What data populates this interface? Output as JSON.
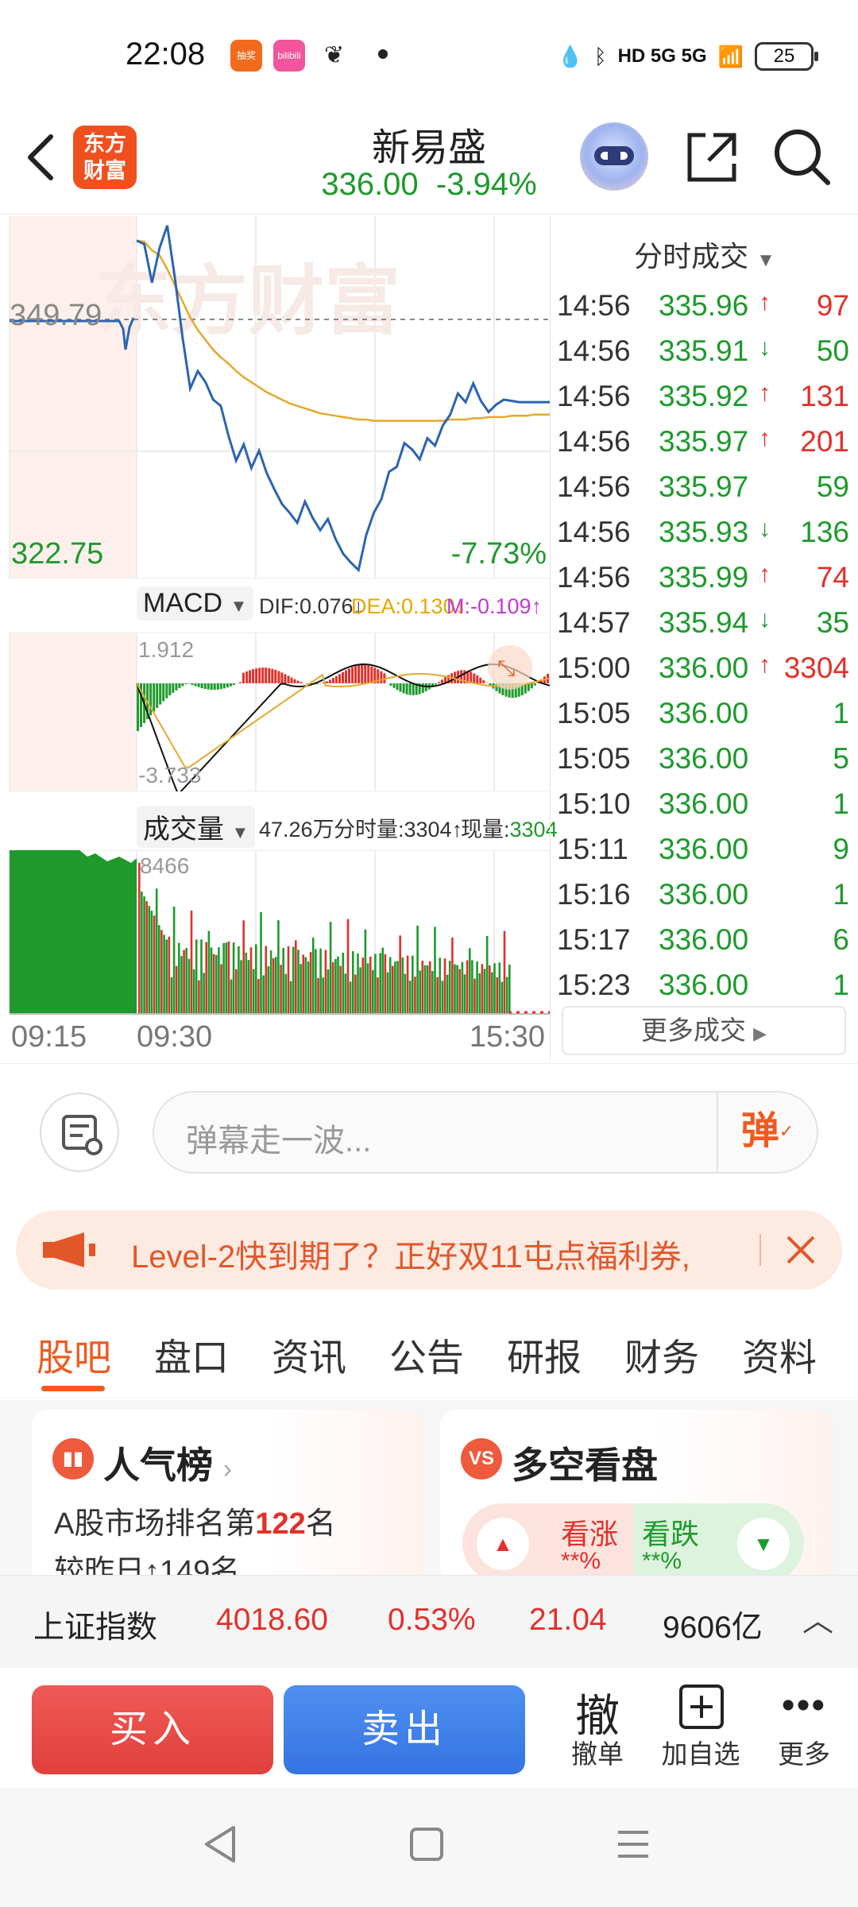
{
  "status_bar": {
    "time": "22:08",
    "app_icons": [
      "抽奖",
      "bilibili"
    ],
    "network": "HD 5G 5G",
    "battery": "25"
  },
  "header": {
    "logo_text": "东方财富",
    "stock_name": "新易盛",
    "price": "336.00",
    "change_pct": "-3.94%"
  },
  "intraday_chart": {
    "watermark": "东方财富",
    "ref_price": "349.79",
    "low_price": "322.75",
    "low_pct": "-7.73%",
    "macd": {
      "selector": "MACD",
      "dif": "DIF:0.076",
      "dea": "DEA:0.130",
      "m": "M:-0.109",
      "top_value": "1.912",
      "bottom_value": "-3.733"
    },
    "volume": {
      "selector": "成交量",
      "total": "47.26万",
      "minute_vol": "分时量:3304",
      "now_label": "现量:",
      "now_value": "3304",
      "max_value": "8466"
    },
    "time_axis": [
      "09:15",
      "09:30",
      "15:30"
    ]
  },
  "chart_data": {
    "type": "line",
    "title": "",
    "ylim": [
      322.75,
      376.83
    ],
    "ref_line": 349.79,
    "x_ticks": [
      "09:15",
      "09:30",
      "15:30"
    ],
    "series": [
      {
        "values": [
          349.79,
          349.5,
          346.4,
          349.2,
          351.0,
          346.8,
          342.0,
          337.9,
          339.3,
          338.4,
          337.0,
          336.5,
          334.1,
          332.1,
          333.4,
          331.5,
          332.9,
          331.1,
          329.8,
          328.6,
          327.9,
          327.1,
          328.8,
          327.5,
          326.5,
          327.4,
          325.8,
          324.6,
          323.9,
          323.3,
          326.1,
          327.9,
          329.0,
          331.2,
          331.6,
          333.5,
          333.0,
          332.2,
          333.9,
          333.3,
          334.9,
          335.8,
          337.5,
          336.8,
          338.3,
          336.9,
          336.0,
          336.6,
          337.0,
          336.9,
          336.8,
          336.8,
          336.8,
          336.8,
          336.8
        ]
      },
      {
        "values": [
          349.79,
          349.7,
          349.0,
          348.6,
          347.5,
          346.2,
          344.9,
          343.6,
          342.6,
          341.8,
          341.0,
          340.4,
          339.9,
          339.3,
          338.8,
          338.4,
          338.0,
          337.6,
          337.3,
          337.0,
          336.7,
          336.5,
          336.3,
          336.1,
          335.9,
          335.8,
          335.7,
          335.6,
          335.5,
          335.4,
          335.4,
          335.3,
          335.3,
          335.3,
          335.3,
          335.3,
          335.3,
          335.3,
          335.3,
          335.3,
          335.3,
          335.4,
          335.4,
          335.4,
          335.5,
          335.5,
          335.6,
          335.6,
          335.6,
          335.7,
          335.7,
          335.7,
          335.8,
          335.8,
          335.8
        ]
      }
    ]
  },
  "ticks": {
    "header": "分时成交",
    "rows": [
      {
        "time": "14:56",
        "price": "335.96",
        "dir": "↑",
        "vol": "97"
      },
      {
        "time": "14:56",
        "price": "335.91",
        "dir": "↓",
        "vol": "50"
      },
      {
        "time": "14:56",
        "price": "335.92",
        "dir": "↑",
        "vol": "131"
      },
      {
        "time": "14:56",
        "price": "335.97",
        "dir": "↑",
        "vol": "201"
      },
      {
        "time": "14:56",
        "price": "335.97",
        "dir": "",
        "vol": "59"
      },
      {
        "time": "14:56",
        "price": "335.93",
        "dir": "↓",
        "vol": "136"
      },
      {
        "time": "14:56",
        "price": "335.99",
        "dir": "↑",
        "vol": "74"
      },
      {
        "time": "14:57",
        "price": "335.94",
        "dir": "↓",
        "vol": "35"
      },
      {
        "time": "15:00",
        "price": "336.00",
        "dir": "↑",
        "vol": "3304"
      },
      {
        "time": "15:05",
        "price": "336.00",
        "dir": "",
        "vol": "1"
      },
      {
        "time": "15:05",
        "price": "336.00",
        "dir": "",
        "vol": "5"
      },
      {
        "time": "15:10",
        "price": "336.00",
        "dir": "",
        "vol": "1"
      },
      {
        "time": "15:11",
        "price": "336.00",
        "dir": "",
        "vol": "9"
      },
      {
        "time": "15:16",
        "price": "336.00",
        "dir": "",
        "vol": "1"
      },
      {
        "time": "15:17",
        "price": "336.00",
        "dir": "",
        "vol": "6"
      },
      {
        "time": "15:23",
        "price": "336.00",
        "dir": "",
        "vol": "1"
      }
    ],
    "more": "更多成交"
  },
  "comment": {
    "placeholder": "弹幕走一波...",
    "danmu_btn": "弹"
  },
  "banner": {
    "text": "Level-2快到期了？正好双11屯点福利券,"
  },
  "tabs": [
    "股吧",
    "盘口",
    "资讯",
    "公告",
    "研报",
    "财务",
    "资料"
  ],
  "cards": {
    "popularity": {
      "title": "人气榜",
      "line1_prefix": "A股市场排名第",
      "rank": "122",
      "line1_suffix": "名",
      "line2": "较昨日↑149名"
    },
    "bull_bear": {
      "title": "多空看盘",
      "bull": "看涨",
      "bear": "看跌",
      "bull_pct": "**%",
      "bear_pct": "**%"
    }
  },
  "index_bar": {
    "name": "上证指数",
    "value": "4018.60",
    "pct": "0.53%",
    "change": "21.04",
    "turnover": "9606亿"
  },
  "trade_bar": {
    "buy": "买入",
    "sell": "卖出",
    "cancel_icon": "撤",
    "cancel": "撤单",
    "add_watch": "加自选",
    "more": "更多"
  },
  "colors": {
    "up": "#e2302a",
    "down": "#1e9a2c",
    "accent": "#f05a1f",
    "price_line": "#2d64b0",
    "avg_line": "#e5a82e"
  }
}
